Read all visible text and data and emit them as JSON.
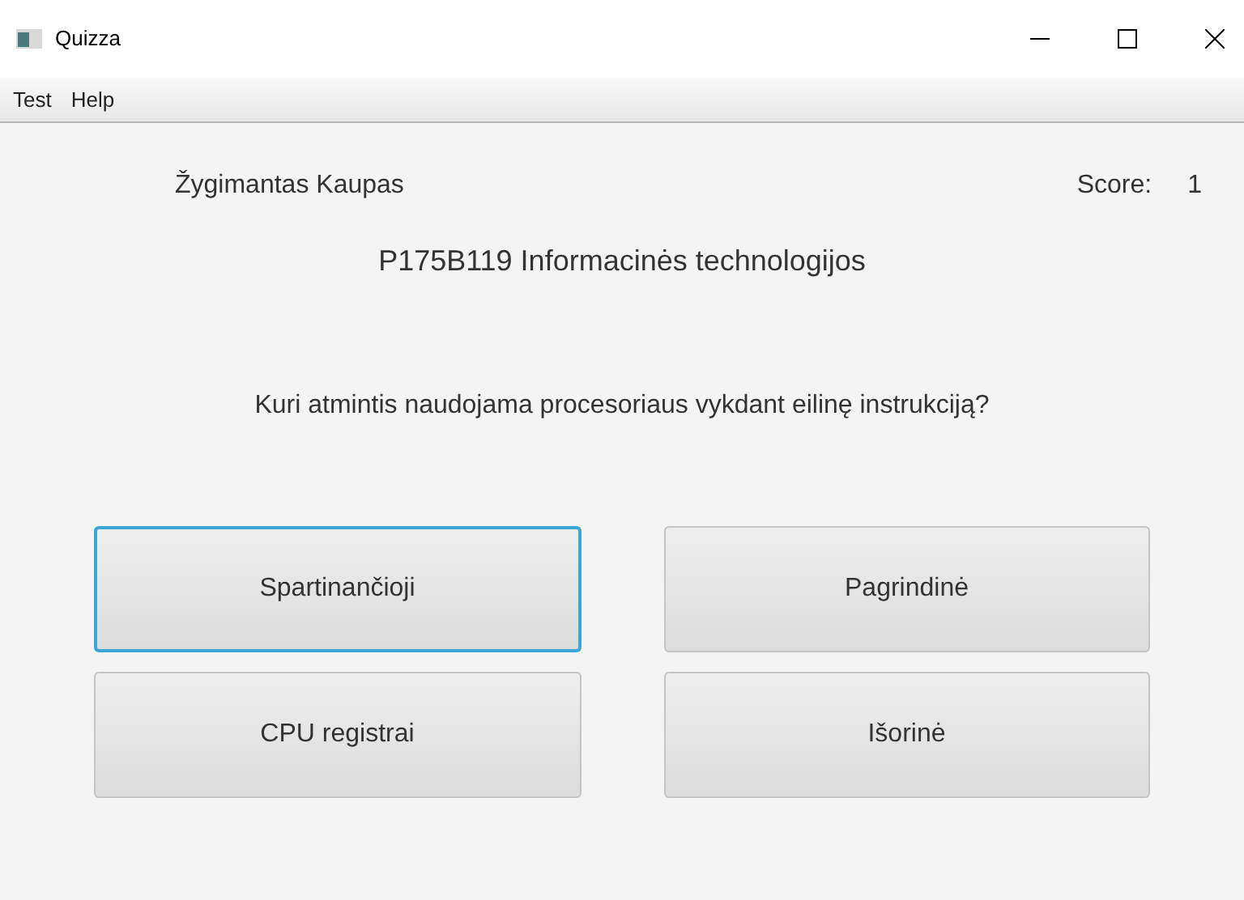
{
  "window": {
    "title": "Quizza"
  },
  "menu": [
    "Test",
    "Help"
  ],
  "student": "Žygimantas Kaupas",
  "score": {
    "label": "Score:",
    "value": "1"
  },
  "course": "P175B119 Informacinės technologijos",
  "question": "Kuri atmintis naudojama procesoriaus vykdant eilinę instrukciją?",
  "answers": [
    {
      "label": "Spartinančioji",
      "focused": true
    },
    {
      "label": "Pagrindinė",
      "focused": false
    },
    {
      "label": "CPU registrai",
      "focused": false
    },
    {
      "label": "Išorinė",
      "focused": false
    }
  ]
}
